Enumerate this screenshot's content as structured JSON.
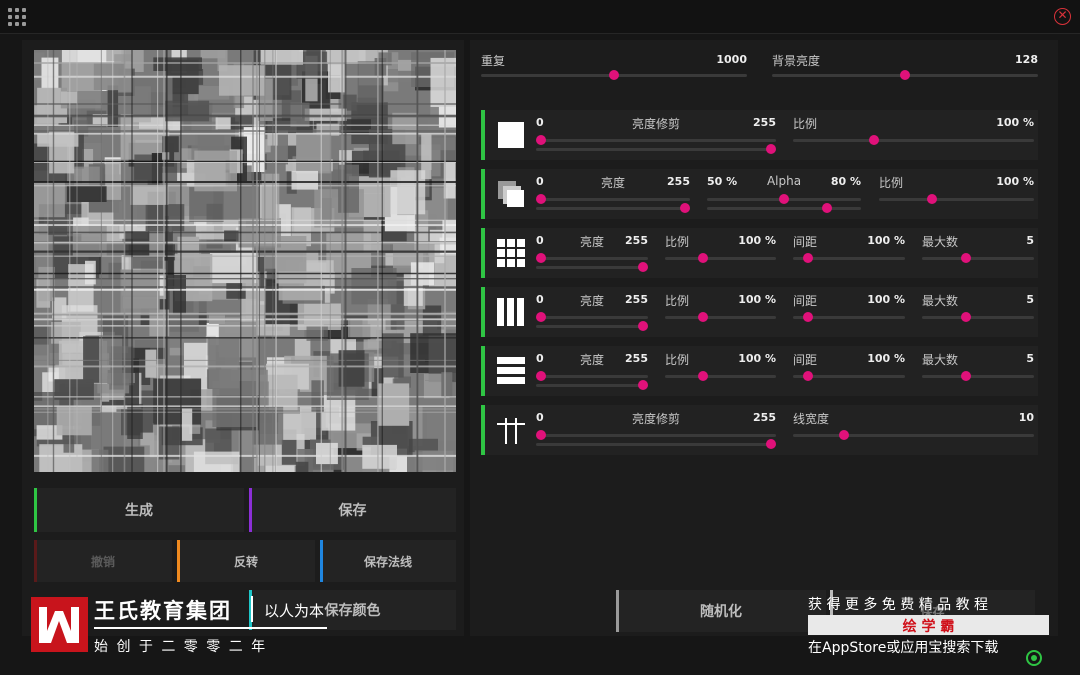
{
  "window": {
    "menu_icon": "grid-menu-icon",
    "close_icon": "close-circle-icon",
    "close_glyph": "✕",
    "accent": "#e0117a",
    "active_bar": "#2fc544"
  },
  "top_sliders": {
    "repeat": {
      "label": "重复",
      "value": "1000",
      "level": 0.5
    },
    "bg_brightness": {
      "label": "背景亮度",
      "value": "128",
      "level": 0.5
    }
  },
  "rows": [
    {
      "icon": "square-icon",
      "sliders": [
        {
          "min": "0",
          "label": "亮度修剪",
          "max": "255",
          "low": 0.0,
          "high": 1.0
        },
        {
          "label": "比例",
          "value": "100 %",
          "level": 0.33
        }
      ]
    },
    {
      "icon": "stacked-squares-icon",
      "sliders": [
        {
          "min": "0",
          "label": "亮度",
          "max": "255",
          "low": 0.0,
          "high": 1.0
        },
        {
          "min": "50 %",
          "label": "Alpha",
          "max": "80 %",
          "low": 0.5,
          "high": 0.8
        },
        {
          "label": "比例",
          "value": "100 %",
          "level": 0.33
        }
      ]
    },
    {
      "icon": "dot-grid-icon",
      "sliders": [
        {
          "min": "0",
          "label": "亮度",
          "max": "255",
          "low": 0.0,
          "high": 1.0
        },
        {
          "label": "比例",
          "value": "100 %",
          "level": 0.33
        },
        {
          "label": "间距",
          "value": "100 %",
          "level": 0.1
        },
        {
          "label": "最大数",
          "value": "5",
          "level": 0.38
        }
      ]
    },
    {
      "icon": "vertical-bars-icon",
      "sliders": [
        {
          "min": "0",
          "label": "亮度",
          "max": "255",
          "low": 0.0,
          "high": 1.0
        },
        {
          "label": "比例",
          "value": "100 %",
          "level": 0.33
        },
        {
          "label": "间距",
          "value": "100 %",
          "level": 0.1
        },
        {
          "label": "最大数",
          "value": "5",
          "level": 0.38
        }
      ]
    },
    {
      "icon": "horizontal-bars-icon",
      "sliders": [
        {
          "min": "0",
          "label": "亮度",
          "max": "255",
          "low": 0.0,
          "high": 1.0
        },
        {
          "label": "比例",
          "value": "100 %",
          "level": 0.33
        },
        {
          "label": "间距",
          "value": "100 %",
          "level": 0.1
        },
        {
          "label": "最大数",
          "value": "5",
          "level": 0.38
        }
      ]
    },
    {
      "icon": "lines-icon",
      "sliders": [
        {
          "min": "0",
          "label": "亮度修剪",
          "max": "255",
          "low": 0.0,
          "high": 1.0
        },
        {
          "label": "线宽度",
          "value": "10",
          "level": 0.2
        }
      ]
    }
  ],
  "buttons": {
    "generate": "生成",
    "save": "保存",
    "undo": "撤销",
    "invert": "反转",
    "save_normal": "保存法线",
    "save_color": "保存颜色",
    "randomize": "随机化",
    "hidden_button": "保存"
  },
  "watermark": {
    "logo_icon": "w-logo-icon",
    "company": "王氏教育集团",
    "slogan": "以人为本",
    "founded": "始 创 于 二 零 零 二 年",
    "promo_line1": "获 得 更 多 免 费 精 品 教 程",
    "promo_brand": "绘 学 霸",
    "promo_line3": "在AppStore或应用宝搜索下载"
  }
}
